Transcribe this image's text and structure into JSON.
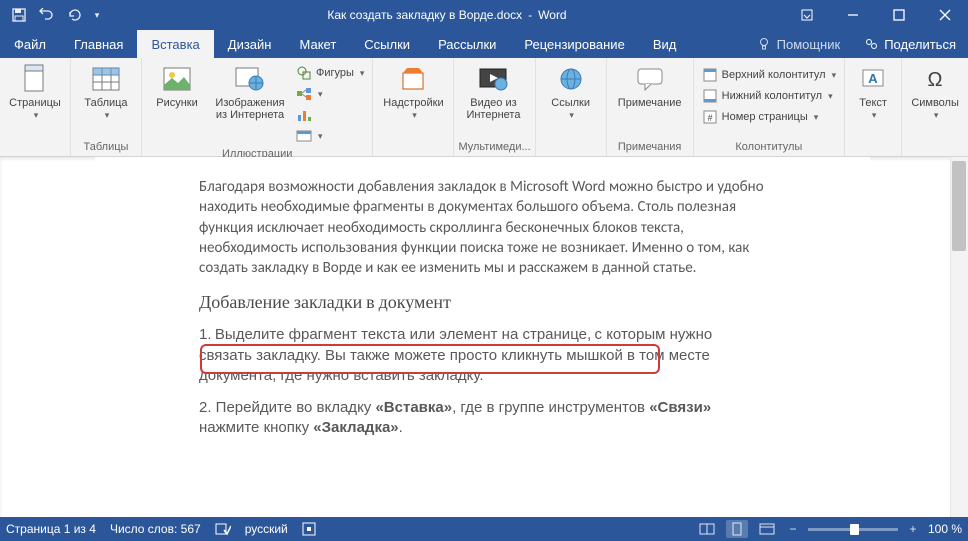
{
  "title": {
    "document": "Как создать закладку в Ворде.docx",
    "app": "Word"
  },
  "tabs": {
    "file": "Файл",
    "home": "Главная",
    "insert": "Вставка",
    "design": "Дизайн",
    "layout": "Макет",
    "references": "Ссылки",
    "mailings": "Рассылки",
    "review": "Рецензирование",
    "view": "Вид"
  },
  "assistant": "Помощник",
  "share": "Поделиться",
  "ribbon": {
    "pages": {
      "label": "Страницы",
      "group": ""
    },
    "tables": {
      "label": "Таблица",
      "group": "Таблицы"
    },
    "illustrations": {
      "group": "Иллюстрации",
      "pictures": "Рисунки",
      "online_pictures": "Изображения из Интернета",
      "shapes": "Фигуры",
      "smartart": "",
      "chart": "",
      "screenshot": ""
    },
    "addins": {
      "label": "Надстройки",
      "group": ""
    },
    "media": {
      "label": "Видео из Интернета",
      "group": "Мультимеди..."
    },
    "links": {
      "label": "Ссылки",
      "group": ""
    },
    "comments": {
      "label": "Примечание",
      "group": "Примечания"
    },
    "headerfooter": {
      "group": "Колонтитулы",
      "header": "Верхний колонтитул",
      "footer": "Нижний колонтитул",
      "pagenum": "Номер страницы"
    },
    "text": {
      "label": "Текст",
      "group": ""
    },
    "symbols": {
      "label": "Символы",
      "group": ""
    }
  },
  "doc": {
    "p1": "Благодаря возможности добавления закладок в Microsoft Word можно быстро и удобно находить необходимые фрагменты в документах большого объема. Столь полезная функция исключает необходимость скроллинга бесконечных блоков текста, необходимость использования функции поиска тоже не возникает. Именно о том, как создать закладку в Ворде и как ее изменить мы и расскажем в данной статье.",
    "h1": "Добавление закладки в документ",
    "p2a": "1.",
    "p2b": "Выделите фрагмент текста или элемент на странице,",
    "p2c": "с которым нужно связать закладку. Вы также можете просто кликнуть мышкой в том месте документа, где нужно вставить закладку.",
    "p3a": "2. Перейдите во вкладку ",
    "p3b": "«Вставка»",
    "p3c": ", где в группе инструментов ",
    "p3d": "«Связи»",
    "p3e": " нажмите кнопку ",
    "p3f": "«Закладка»",
    "p3g": "."
  },
  "status": {
    "page": "Страница 1 из 4",
    "words": "Число слов: 567",
    "lang": "русский",
    "zoom": "100 %"
  }
}
